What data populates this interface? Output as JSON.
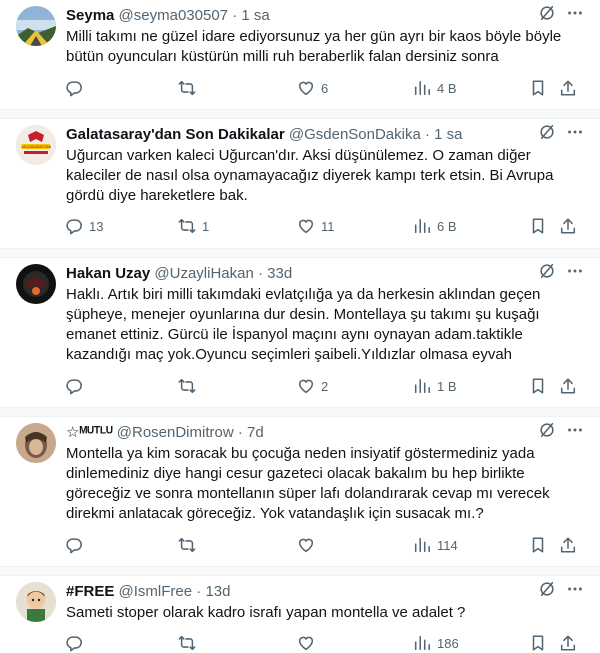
{
  "tweets": [
    {
      "name": "Seyma",
      "handle": "@seyma030507",
      "time": "1 sa",
      "text": "Milli takımı ne güzel idare ediyorsunuz ya her gün ayrı bir kaos böyle böyle\nbütün oyuncuları küstürün milli ruh beraberlik falan dersiniz sonra",
      "replies": "",
      "retweets": "",
      "likes": "6",
      "views": "4 B"
    },
    {
      "name": "Galatasaray'dan Son Dakikalar",
      "handle": "@GsdenSonDakika",
      "time": "1 sa",
      "text": "Uğurcan varken kaleci Uğurcan'dır. Aksi düşünülemez. O zaman diğer\nkaleciler de nasıl olsa oynamayacağız diyerek kampı terk etsin. Bi Avrupa\ngördü diye hareketlere bak.",
      "replies": "13",
      "retweets": "1",
      "likes": "11",
      "views": "6 B",
      "avatar_text": "GALATASARAY'DAN"
    },
    {
      "name": "Hakan Uzay",
      "handle": "@UzayliHakan",
      "time": "33d",
      "text": "Haklı. Artık biri milli takımdaki evlatçılığa ya da herkesin aklından geçen\nşüpheye, menejer oyunlarına dur desin. Montellaya şu takımı şu kuşağı\nemanet ettiniz. Gürcü ile İspanyol maçını aynı oynayan adam.taktikle\nkazandığı maç yok.Oyuncu seçimleri şaibeli.Yıldızlar olmasa eyvah",
      "replies": "",
      "retweets": "",
      "likes": "2",
      "views": "1 B"
    },
    {
      "name": "☆ᴹᵁᵀᴸᵁ",
      "handle": "@RosenDimitrow",
      "time": "7d",
      "text": "Montella ya kim soracak bu çocuğa neden insiyatif göstermediniz yada\ndinlemediniz diye hangi cesur gazeteci olacak bakalım bu hep birlikte\ngöreceğiz ve sonra montellanın süper lafı dolandırarak cevap mı verecek\ndirekmi anlatacak göreceğiz. Yok vatandaşlık için susacak mı.?",
      "replies": "",
      "retweets": "",
      "likes": "",
      "views": "114"
    },
    {
      "name": "#FREE",
      "handle": "@IsmlFree",
      "time": "13d",
      "text": "Sameti stoper olarak kadro israfı yapan montella ve adalet ?",
      "replies": "",
      "retweets": "",
      "likes": "",
      "views": "186"
    }
  ],
  "ui": {
    "dot": "·"
  },
  "icons": {
    "reply": "reply-icon",
    "retweet": "retweet-icon",
    "like": "heart-icon",
    "views": "views-chart-icon",
    "bookmark": "bookmark-icon",
    "share": "share-icon",
    "grok": "grok-icon",
    "more": "more-icon"
  },
  "colors": {
    "text": "#0f1419",
    "secondary": "#536471",
    "divider": "#eff3f4",
    "separator": "#f7f9f9"
  }
}
